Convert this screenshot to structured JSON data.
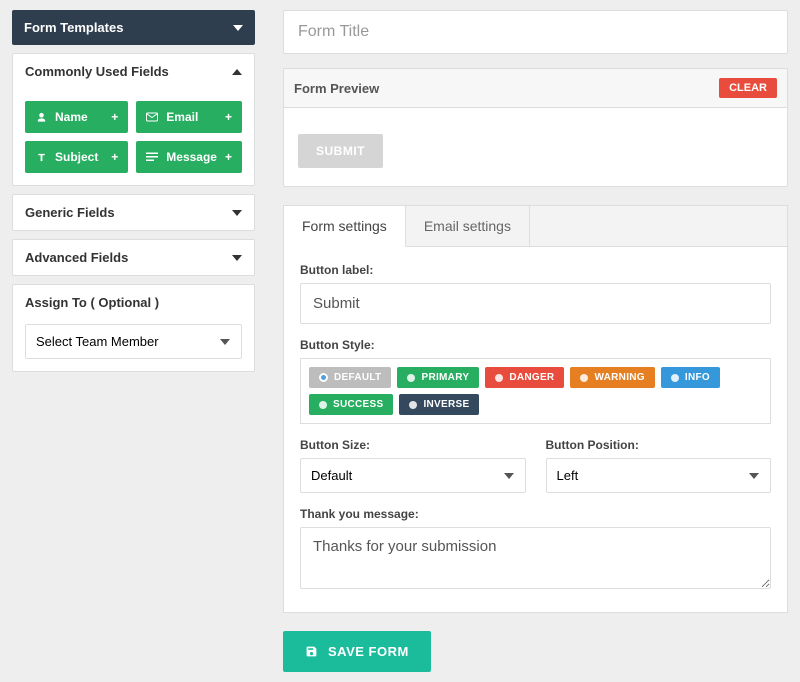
{
  "sidebar": {
    "templates": {
      "title": "Form Templates"
    },
    "common": {
      "title": "Commonly Used Fields",
      "fields": [
        {
          "label": "Name",
          "icon": "user"
        },
        {
          "label": "Email",
          "icon": "mail"
        },
        {
          "label": "Subject",
          "icon": "text"
        },
        {
          "label": "Message",
          "icon": "lines"
        }
      ]
    },
    "generic": {
      "title": "Generic Fields"
    },
    "advanced": {
      "title": "Advanced Fields"
    },
    "assign": {
      "title": "Assign To ( Optional )",
      "placeholder": "Select Team Member"
    }
  },
  "main": {
    "title_placeholder": "Form Title",
    "preview": {
      "label": "Form Preview",
      "clear": "CLEAR",
      "submit": "SUBMIT"
    },
    "tabs": {
      "form": "Form settings",
      "email": "Email settings"
    },
    "settings": {
      "button_label": {
        "label": "Button label:",
        "value": "Submit"
      },
      "button_style": {
        "label": "Button Style:",
        "options": [
          "DEFAULT",
          "PRIMARY",
          "DANGER",
          "WARNING",
          "INFO",
          "SUCCESS",
          "INVERSE"
        ]
      },
      "button_size": {
        "label": "Button Size:",
        "value": "Default"
      },
      "button_position": {
        "label": "Button Position:",
        "value": "Left"
      },
      "thank_you": {
        "label": "Thank you message:",
        "value": "Thanks for your submission"
      }
    },
    "save": "SAVE FORM"
  }
}
